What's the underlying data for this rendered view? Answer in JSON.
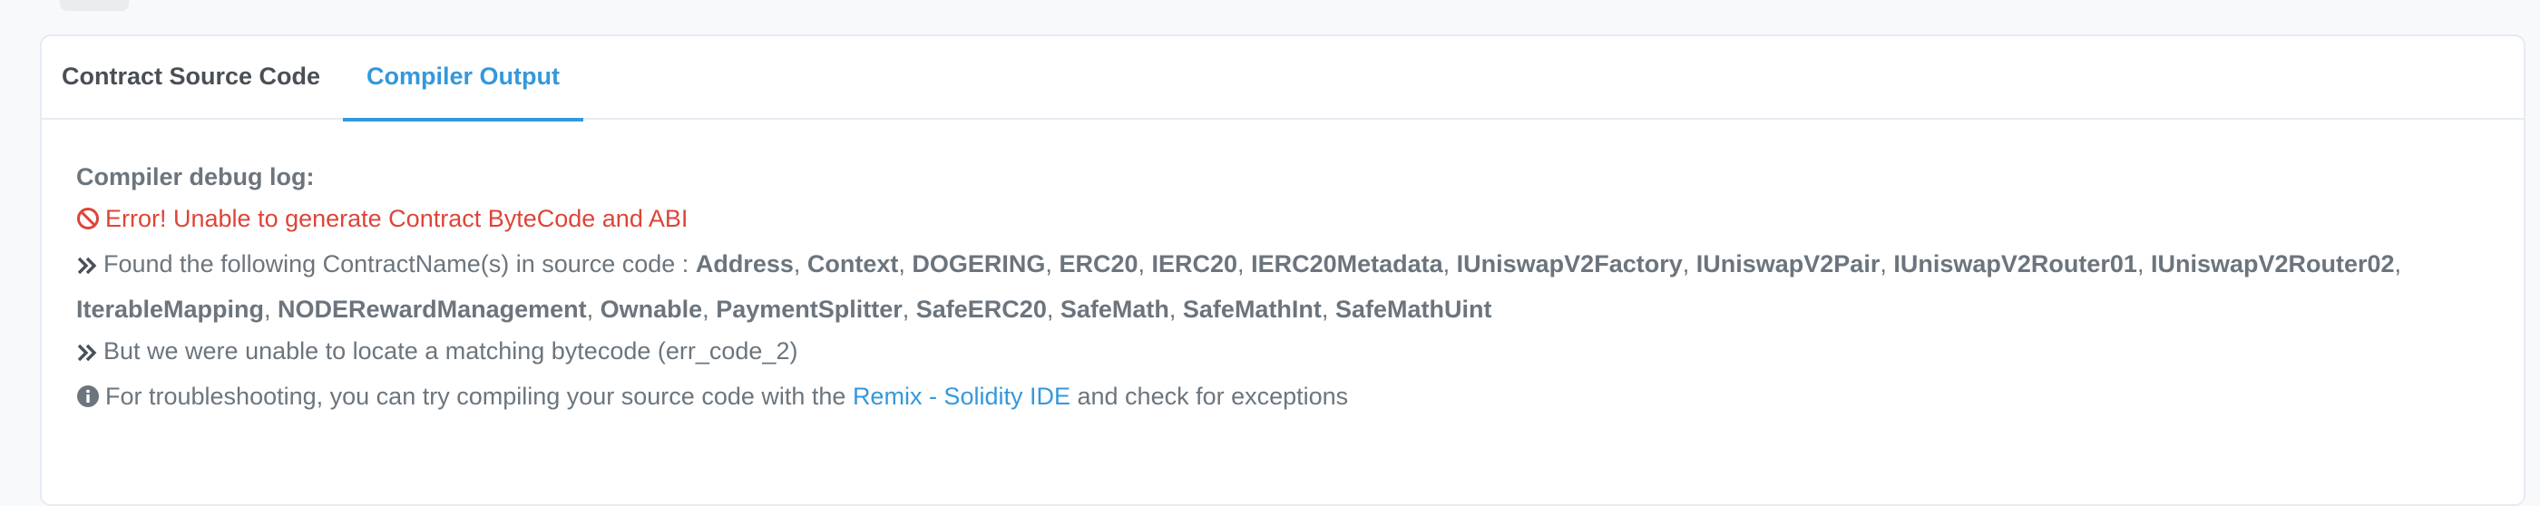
{
  "tabs": [
    {
      "label": "Contract Source Code"
    },
    {
      "label": "Compiler Output"
    }
  ],
  "log": {
    "heading": "Compiler debug log:",
    "error": "Error! Unable to generate Contract ByteCode and ABI",
    "found_prefix": "Found the following ContractName(s) in source code :",
    "contract_names": [
      "Address",
      "Context",
      "DOGERING",
      "ERC20",
      "IERC20",
      "IERC20Metadata",
      "IUniswapV2Factory",
      "IUniswapV2Pair",
      "IUniswapV2Router01",
      "IUniswapV2Router02",
      "IterableMapping",
      "NODERewardManagement",
      "Ownable",
      "PaymentSplitter",
      "SafeERC20",
      "SafeMath",
      "SafeMathInt",
      "SafeMathUint"
    ],
    "bytecode_msg": "But we were unable to locate a matching bytecode (err_code_2)",
    "troubleshoot_prefix": "For troubleshooting, you can try compiling your source code with the",
    "remix_link": "Remix - Solidity IDE",
    "troubleshoot_suffix": "and check for exceptions"
  },
  "colors": {
    "accent": "#3498db",
    "error": "#de4437",
    "text": "#6c757d"
  }
}
